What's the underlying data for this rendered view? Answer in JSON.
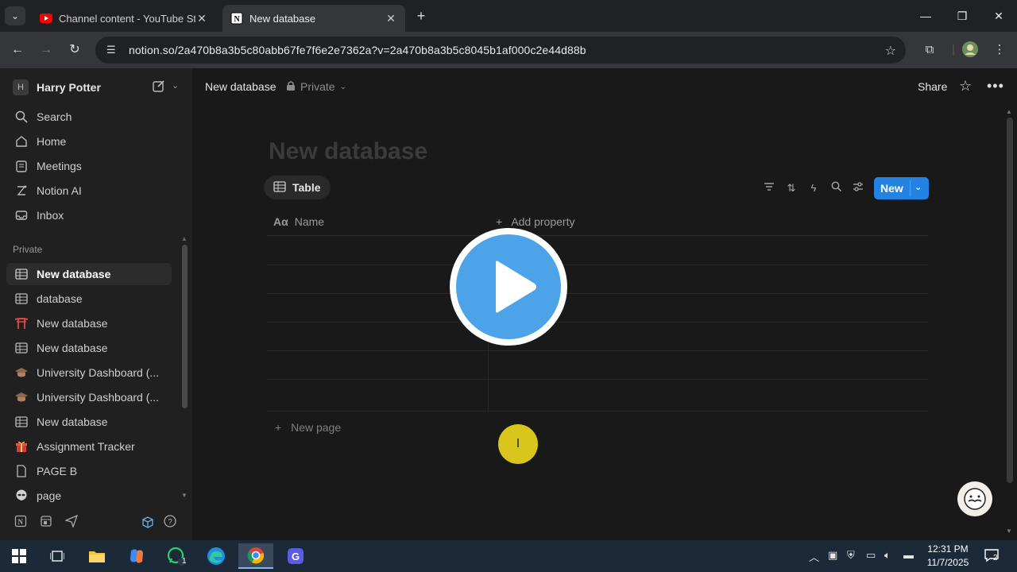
{
  "browser": {
    "tabs": [
      {
        "title": "Channel content - YouTube Studio",
        "favicon": "youtube-icon"
      },
      {
        "title": "New database",
        "favicon": "notion-icon"
      }
    ],
    "url": "notion.so/2a470b8a3b5c80abb67fe7f6e2e7362a?v=2a470b8a3b5c8045b1af000c2e44d88b"
  },
  "sidebar": {
    "workspace_initial": "H",
    "workspace_name": "Harry Potter",
    "nav": [
      {
        "label": "Search",
        "icon": "search-icon"
      },
      {
        "label": "Home",
        "icon": "home-icon"
      },
      {
        "label": "Meetings",
        "icon": "meetings-icon"
      },
      {
        "label": "Notion AI",
        "icon": "ai-icon"
      },
      {
        "label": "Inbox",
        "icon": "inbox-icon"
      }
    ],
    "section_label": "Private",
    "pages": [
      {
        "label": "New database",
        "icon": "table-icon"
      },
      {
        "label": "database",
        "icon": "table-icon"
      },
      {
        "label": "New database",
        "icon": "torii-icon"
      },
      {
        "label": "New database",
        "icon": "table-icon"
      },
      {
        "label": "University Dashboard (...",
        "icon": "graduation-cap-icon"
      },
      {
        "label": "University Dashboard (...",
        "icon": "graduation-cap-icon"
      },
      {
        "label": "New database",
        "icon": "table-icon"
      },
      {
        "label": "Assignment Tracker",
        "icon": "gift-icon"
      },
      {
        "label": "PAGE B",
        "icon": "page-icon"
      },
      {
        "label": "page",
        "icon": "alien-icon"
      }
    ]
  },
  "topbar": {
    "title": "New database",
    "privacy": "Private",
    "share": "Share"
  },
  "database": {
    "title": "New database",
    "view_tab": "Table",
    "new_button": "New",
    "column_name": "Name",
    "add_property": "Add property",
    "new_page": "New page"
  },
  "taskbar": {
    "time": "12:31 PM",
    "date": "11/7/2025",
    "whatsapp_badge": "1",
    "notification_badge": "2"
  },
  "colors": {
    "accent": "#2383e2",
    "background": "#191919",
    "sidebar": "#202020",
    "play": "#4da3e8"
  }
}
